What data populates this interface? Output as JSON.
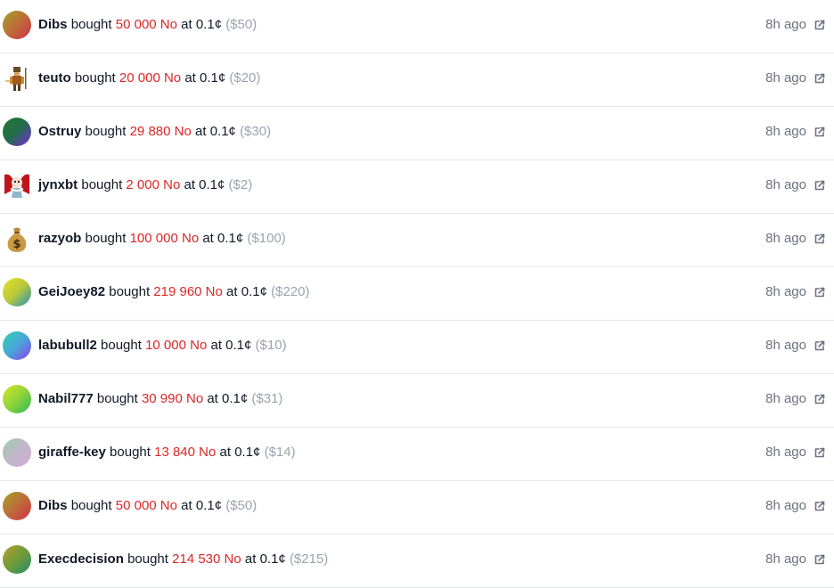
{
  "feed": {
    "items": [
      {
        "user": "Dibs",
        "verb": "bought",
        "amount": "50 000 No",
        "at": "at",
        "price": "0.1¢",
        "dollars": "($50)",
        "time": "8h ago",
        "avatar": "gradient-olive-red",
        "link_icon": "external-link-icon"
      },
      {
        "user": "teuto",
        "verb": "bought",
        "amount": "20 000 No",
        "at": "at",
        "price": "0.1¢",
        "dollars": "($20)",
        "time": "8h ago",
        "avatar": "pixel-character",
        "link_icon": "external-link-icon"
      },
      {
        "user": "Ostruy",
        "verb": "bought",
        "amount": "29 880 No",
        "at": "at",
        "price": "0.1¢",
        "dollars": "($30)",
        "time": "8h ago",
        "avatar": "gradient-green-purple",
        "link_icon": "external-link-icon"
      },
      {
        "user": "jynxbt",
        "verb": "bought",
        "amount": "2 000 No",
        "at": "at",
        "price": "0.1¢",
        "dollars": "($2)",
        "time": "8h ago",
        "avatar": "jester-character",
        "link_icon": "external-link-icon"
      },
      {
        "user": "razyob",
        "verb": "bought",
        "amount": "100 000 No",
        "at": "at",
        "price": "0.1¢",
        "dollars": "($100)",
        "time": "8h ago",
        "avatar": "money-bag",
        "link_icon": "external-link-icon"
      },
      {
        "user": "GeiJoey82",
        "verb": "bought",
        "amount": "219 960 No",
        "at": "at",
        "price": "0.1¢",
        "dollars": "($220)",
        "time": "8h ago",
        "avatar": "gradient-yellow-teal",
        "link_icon": "external-link-icon"
      },
      {
        "user": "labubull2",
        "verb": "bought",
        "amount": "10 000 No",
        "at": "at",
        "price": "0.1¢",
        "dollars": "($10)",
        "time": "8h ago",
        "avatar": "gradient-teal-purple",
        "link_icon": "external-link-icon"
      },
      {
        "user": "Nabil777",
        "verb": "bought",
        "amount": "30 990 No",
        "at": "at",
        "price": "0.1¢",
        "dollars": "($31)",
        "time": "8h ago",
        "avatar": "gradient-lime-green",
        "link_icon": "external-link-icon"
      },
      {
        "user": "giraffe-key",
        "verb": "bought",
        "amount": "13 840 No",
        "at": "at",
        "price": "0.1¢",
        "dollars": "($14)",
        "time": "8h ago",
        "avatar": "gradient-pastel",
        "link_icon": "external-link-icon"
      },
      {
        "user": "Dibs",
        "verb": "bought",
        "amount": "50 000 No",
        "at": "at",
        "price": "0.1¢",
        "dollars": "($50)",
        "time": "8h ago",
        "avatar": "gradient-olive-red",
        "link_icon": "external-link-icon"
      },
      {
        "user": "Execdecision",
        "verb": "bought",
        "amount": "214 530 No",
        "at": "at",
        "price": "0.1¢",
        "dollars": "($215)",
        "time": "8h ago",
        "avatar": "gradient-olive-green",
        "link_icon": "external-link-icon"
      }
    ]
  },
  "colors": {
    "amount_red": "#dc2626",
    "muted_gray": "#9ca3af",
    "time_gray": "#6b7280",
    "divider": "#e5e7eb"
  }
}
